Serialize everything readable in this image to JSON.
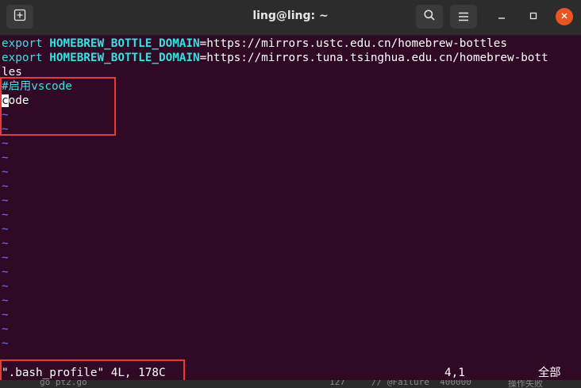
{
  "window": {
    "title": "ling@ling: ~"
  },
  "terminal": {
    "lines": [
      {
        "kw": "export",
        "var": "HOMEBREW_BOTTLE_DOMAIN",
        "val": "=https://mirrors.ustc.edu.cn/homebrew-bottles"
      },
      {
        "kw": "export",
        "var": "HOMEBREW_BOTTLE_DOMAIN",
        "val": "=https://mirrors.tuna.tsinghua.edu.cn/homebrew-bott"
      },
      {
        "text": "les"
      },
      {
        "comment": "#启用vscode"
      },
      {
        "cursor": "c",
        "rest": "ode"
      }
    ],
    "tilde": "~"
  },
  "status": {
    "file_info": "\".bash_profile\" 4L, 178C",
    "position": "4,1",
    "scroll": "全部"
  },
  "background_strip": {
    "left": "go pt2.go",
    "line_no": "127",
    "code": "// @Failure  400000",
    "tail": "操作失败"
  },
  "colors": {
    "terminal_bg": "#300a24",
    "keyword": "#34e2e2",
    "tilde": "#6f6fff",
    "highlight_box": "#e23b3b",
    "close_button": "#e95420"
  }
}
